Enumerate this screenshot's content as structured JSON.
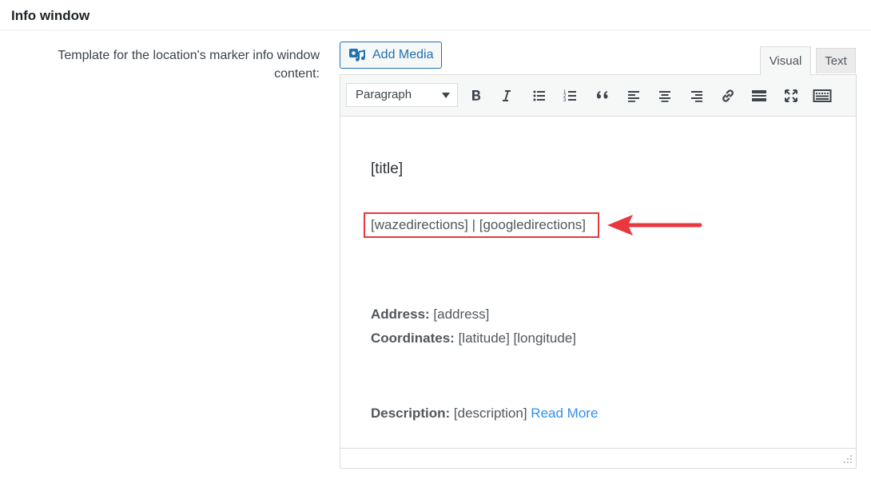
{
  "section": {
    "title": "Info window"
  },
  "field": {
    "label": "Template for the location's marker info window content:"
  },
  "media": {
    "add_label": "Add Media"
  },
  "tabs": {
    "visual": "Visual",
    "text": "Text"
  },
  "toolbar": {
    "format_value": "Paragraph",
    "buttons": [
      "bold-icon",
      "italic-icon",
      "bullet-list-icon",
      "numbered-list-icon",
      "blockquote-icon",
      "align-left-icon",
      "align-center-icon",
      "align-right-icon",
      "link-icon",
      "read-more-tag-icon",
      "fullscreen-icon",
      "toolbar-toggle-icon"
    ]
  },
  "content": {
    "title": "[title]",
    "directions": "[wazedirections] | [googledirections]",
    "address_label": "Address:",
    "address_value": " [address]",
    "coords_label": "Coordinates:",
    "coords_value": " [latitude] [longitude]",
    "desc_label": "Description:",
    "desc_value": " [description] ",
    "read_more": "Read More"
  },
  "colors": {
    "accent": "#2271b1",
    "annotation": "#e8383d",
    "link": "#2f8ff0"
  }
}
